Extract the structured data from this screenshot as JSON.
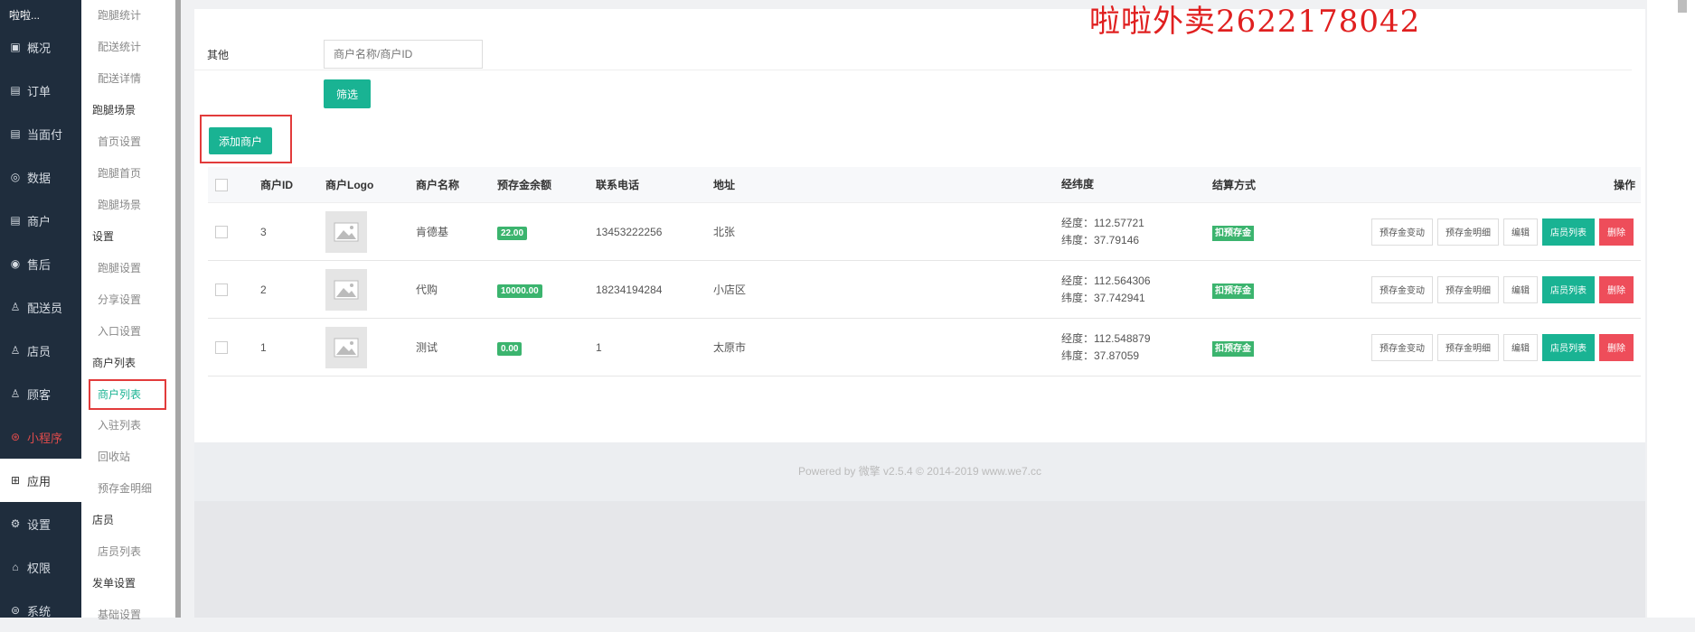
{
  "left_nav": {
    "top_title": "啦啦...",
    "items": [
      {
        "icon": "overview-icon",
        "glyph": "▣",
        "label": "概况"
      },
      {
        "icon": "orders-icon",
        "glyph": "▤",
        "label": "订单"
      },
      {
        "icon": "pay-icon",
        "glyph": "▤",
        "label": "当面付"
      },
      {
        "icon": "data-icon",
        "glyph": "◎",
        "label": "数据"
      },
      {
        "icon": "merchant-icon",
        "glyph": "▤",
        "label": "商户"
      },
      {
        "icon": "aftersale-icon",
        "glyph": "◉",
        "label": "售后"
      },
      {
        "icon": "courier-icon",
        "glyph": "♙",
        "label": "配送员"
      },
      {
        "icon": "clerk-icon",
        "glyph": "♙",
        "label": "店员"
      },
      {
        "icon": "customer-icon",
        "glyph": "♙",
        "label": "顾客"
      },
      {
        "icon": "miniapp-icon",
        "glyph": "⊛",
        "label": "小程序"
      },
      {
        "icon": "apps-icon",
        "glyph": "⊞",
        "label": "应用"
      },
      {
        "icon": "settings-icon",
        "glyph": "⚙",
        "label": "设置"
      },
      {
        "icon": "permission-icon",
        "glyph": "⌂",
        "label": "权限"
      },
      {
        "icon": "system-icon",
        "glyph": "⊜",
        "label": "系统"
      }
    ]
  },
  "sub_nav": {
    "entries": [
      {
        "type": "item",
        "label": "跑腿统计"
      },
      {
        "type": "item",
        "label": "配送统计"
      },
      {
        "type": "item",
        "label": "配送详情"
      },
      {
        "type": "group",
        "label": "跑腿场景"
      },
      {
        "type": "item",
        "label": "首页设置"
      },
      {
        "type": "item",
        "label": "跑腿首页"
      },
      {
        "type": "item",
        "label": "跑腿场景"
      },
      {
        "type": "group",
        "label": "设置"
      },
      {
        "type": "item",
        "label": "跑腿设置"
      },
      {
        "type": "item",
        "label": "分享设置"
      },
      {
        "type": "item",
        "label": "入口设置"
      },
      {
        "type": "group",
        "label": "商户列表"
      },
      {
        "type": "active",
        "label": "商户列表"
      },
      {
        "type": "item",
        "label": "入驻列表"
      },
      {
        "type": "item",
        "label": "回收站"
      },
      {
        "type": "item",
        "label": "预存金明细"
      },
      {
        "type": "group",
        "label": "店员"
      },
      {
        "type": "item",
        "label": "店员列表"
      },
      {
        "type": "group",
        "label": "发单设置"
      },
      {
        "type": "item",
        "label": "基础设置"
      }
    ]
  },
  "watermark": "啦啦外卖2622178042",
  "filter": {
    "label": "其他",
    "placeholder": "商户名称/商户ID",
    "button": "筛选"
  },
  "add_button": "添加商户",
  "table": {
    "headers": {
      "id": "商户ID",
      "logo": "商户Logo",
      "name": "商户名称",
      "balance": "预存金余额",
      "phone": "联系电话",
      "address": "地址",
      "geo": "经纬度",
      "settle": "结算方式",
      "ops": "操作"
    },
    "rows": [
      {
        "id": "3",
        "name": "肯德基",
        "balance": "22.00",
        "phone": "13453222256",
        "address": "北张",
        "lng": "经度：112.57721",
        "lat": "纬度：37.79146",
        "settle": "扣预存金"
      },
      {
        "id": "2",
        "name": "代购",
        "balance": "10000.00",
        "phone": "18234194284",
        "address": "小店区",
        "lng": "经度：112.564306",
        "lat": "纬度：37.742941",
        "settle": "扣预存金"
      },
      {
        "id": "1",
        "name": "测试",
        "balance": "0.00",
        "phone": "1",
        "address": "太原市",
        "lng": "经度：112.548879",
        "lat": "纬度：37.87059",
        "settle": "扣预存金"
      }
    ],
    "ops": {
      "change": "预存金变动",
      "detail": "预存金明细",
      "edit": "编辑",
      "clerks": "店员列表",
      "delete": "删除"
    }
  },
  "footer": "Powered by 微擎 v2.5.4 © 2014-2019 www.we7.cc",
  "colors": {
    "accent": "#19b393",
    "danger": "#ee4d5a",
    "badge": "#3bb46e",
    "nav_bg": "#1f2d3d"
  }
}
